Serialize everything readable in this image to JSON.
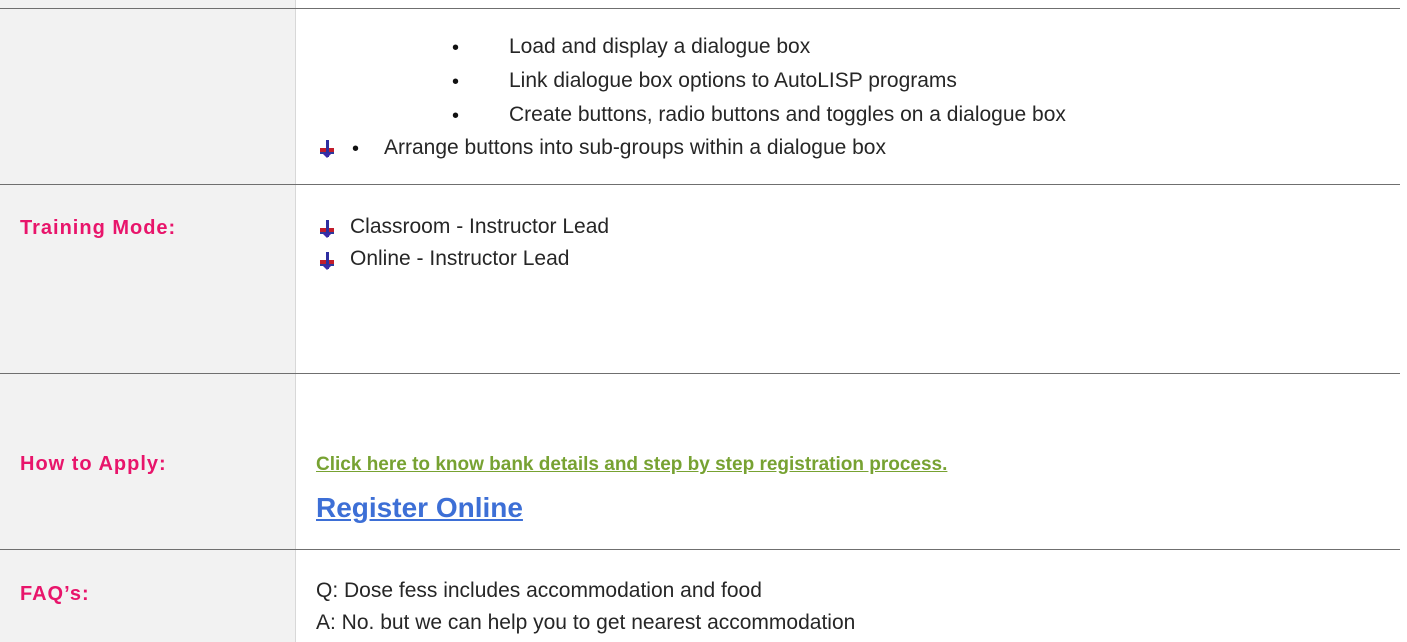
{
  "objectives": {
    "items": [
      "Load and display a dialogue box",
      "Link dialogue box options to AutoLISP programs",
      "Create buttons, radio buttons and toggles on a dialogue box",
      "Arrange buttons into sub-groups within a dialogue box"
    ],
    "bullet": "•"
  },
  "training_mode": {
    "label": "Training Mode:",
    "items": [
      "Classroom - Instructor Lead",
      "Online - Instructor Lead"
    ]
  },
  "how_to_apply": {
    "label": "How to Apply:",
    "bank_link": "Click here to know bank details and step by step registration process.",
    "register_link": "Register Online"
  },
  "faqs": {
    "label": "FAQ’s:",
    "question": "Q: Dose fess includes accommodation and food",
    "answer": "A: No. but we can help you to get nearest accommodation"
  },
  "colors": {
    "label": "#e8156b",
    "link_green": "#77a232",
    "link_blue": "#3d6fd6",
    "left_column_bg": "#f2f2f2"
  },
  "icons": {
    "list_marker": "arrow-down-icon"
  }
}
